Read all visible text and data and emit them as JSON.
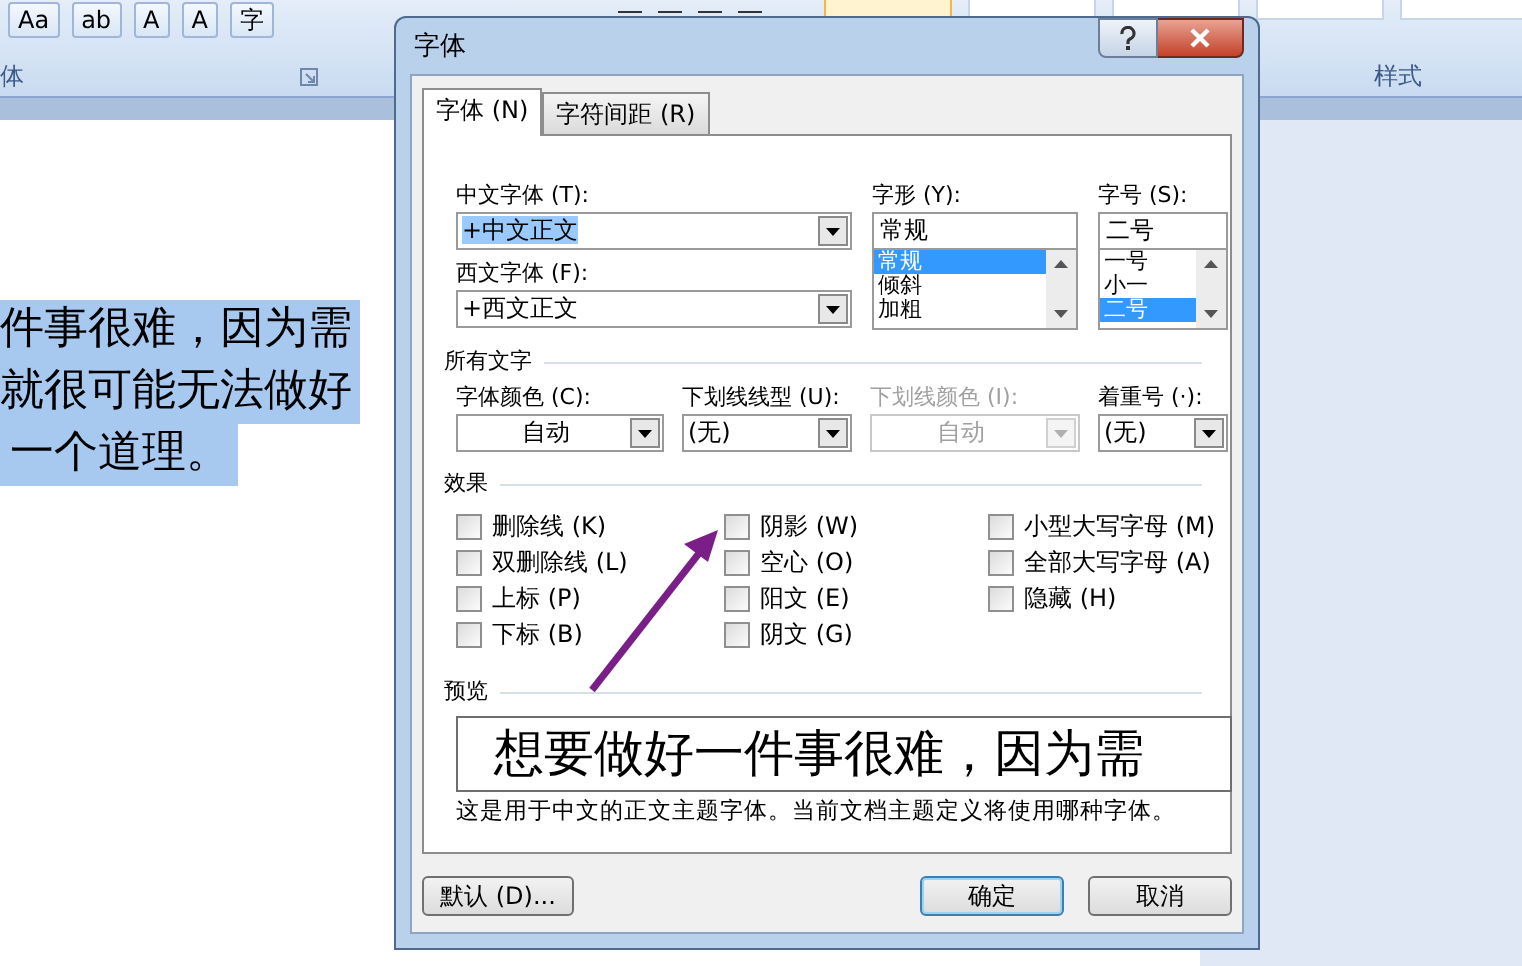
{
  "ribbon": {
    "font_buttons": [
      "Aa",
      "ab",
      "A",
      "A",
      "字"
    ],
    "group_labels": [
      "体",
      "样式"
    ]
  },
  "document": {
    "lines": [
      {
        "text": "件事很难，因为需",
        "selected": true
      },
      {
        "text": "就很可能无法做好",
        "selected": true
      },
      {
        "text": "一个道理。",
        "selected": true
      }
    ]
  },
  "dialog": {
    "title": "字体",
    "tabs": [
      {
        "label": "字体 (N)",
        "selected": true
      },
      {
        "label": "字符间距 (R)",
        "selected": false
      }
    ],
    "chinese_font": {
      "label": "中文字体 (T):",
      "value": "+中文正文"
    },
    "western_font": {
      "label": "西文字体 (F):",
      "value": "+西文正文"
    },
    "font_style": {
      "label": "字形 (Y):",
      "value": "常规",
      "options": [
        {
          "label": "常规",
          "selected": true
        },
        {
          "label": "倾斜",
          "selected": false
        },
        {
          "label": "加粗",
          "selected": false
        }
      ]
    },
    "font_size": {
      "label": "字号 (S):",
      "value": "二号",
      "options": [
        {
          "label": "一号",
          "selected": false
        },
        {
          "label": "小一",
          "selected": false
        },
        {
          "label": "二号",
          "selected": true
        }
      ]
    },
    "all_text": {
      "heading": "所有文字",
      "dropdowns": [
        {
          "label": "字体颜色 (C):",
          "value": "自动",
          "disabled": false,
          "centered": true
        },
        {
          "label": "下划线线型 (U):",
          "value": "(无)",
          "disabled": false,
          "centered": false
        },
        {
          "label": "下划线颜色 (I):",
          "value": "自动",
          "disabled": true,
          "centered": true
        },
        {
          "label": "着重号 (·):",
          "value": "(无)",
          "disabled": false,
          "centered": false
        }
      ]
    },
    "effects": {
      "heading": "效果",
      "columns": [
        [
          {
            "label": "删除线 (K)",
            "checked": false
          },
          {
            "label": "双删除线 (L)",
            "checked": false
          },
          {
            "label": "上标 (P)",
            "checked": false
          },
          {
            "label": "下标 (B)",
            "checked": false
          }
        ],
        [
          {
            "label": "阴影 (W)",
            "checked": false
          },
          {
            "label": "空心 (O)",
            "checked": false
          },
          {
            "label": "阳文 (E)",
            "checked": false
          },
          {
            "label": "阴文 (G)",
            "checked": false
          }
        ],
        [
          {
            "label": "小型大写字母 (M)",
            "checked": false
          },
          {
            "label": "全部大写字母 (A)",
            "checked": false
          },
          {
            "label": "隐藏 (H)",
            "checked": false
          }
        ]
      ]
    },
    "preview": {
      "heading": "预览",
      "sample": "想要做好一件事很难，因为需",
      "note": "这是用于中文的正文主题字体。当前文档主题定义将使用哪种字体。"
    },
    "buttons": [
      {
        "label": "默认 (D)...",
        "kind": "default"
      },
      {
        "label": "确定",
        "kind": "primary"
      },
      {
        "label": "取消",
        "kind": "normal"
      }
    ]
  }
}
